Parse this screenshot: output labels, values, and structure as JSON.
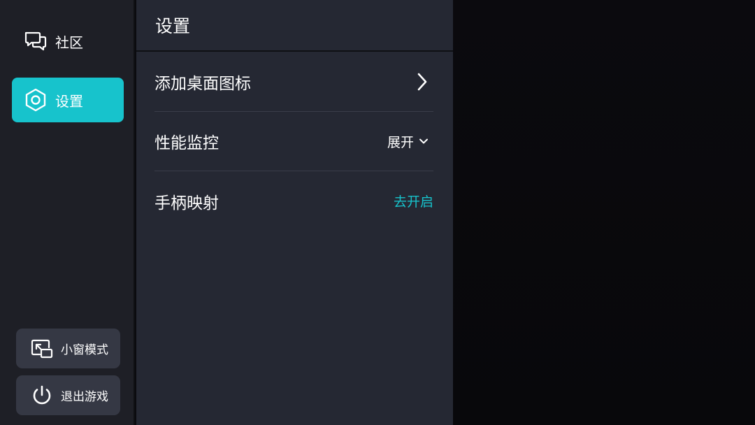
{
  "sidebar": {
    "nav": [
      {
        "label": "社区",
        "icon": "chat-bubbles-icon",
        "active": false
      },
      {
        "label": "设置",
        "icon": "hexagon-settings-icon",
        "active": true
      }
    ],
    "bottom": [
      {
        "label": "小窗模式",
        "icon": "picture-in-picture-icon"
      },
      {
        "label": "退出游戏",
        "icon": "power-icon"
      }
    ]
  },
  "panel": {
    "title": "设置",
    "rows": [
      {
        "label": "添加桌面图标",
        "control": "chevron-right-icon"
      },
      {
        "label": "性能监控",
        "value": "展开",
        "control": "chevron-down-icon"
      },
      {
        "label": "手柄映射",
        "action": "去开启"
      }
    ]
  },
  "colors": {
    "accent": "#17c3cc",
    "sidebar_bg": "#1e1f26",
    "panel_bg": "#252833",
    "button_bg": "#353844"
  }
}
